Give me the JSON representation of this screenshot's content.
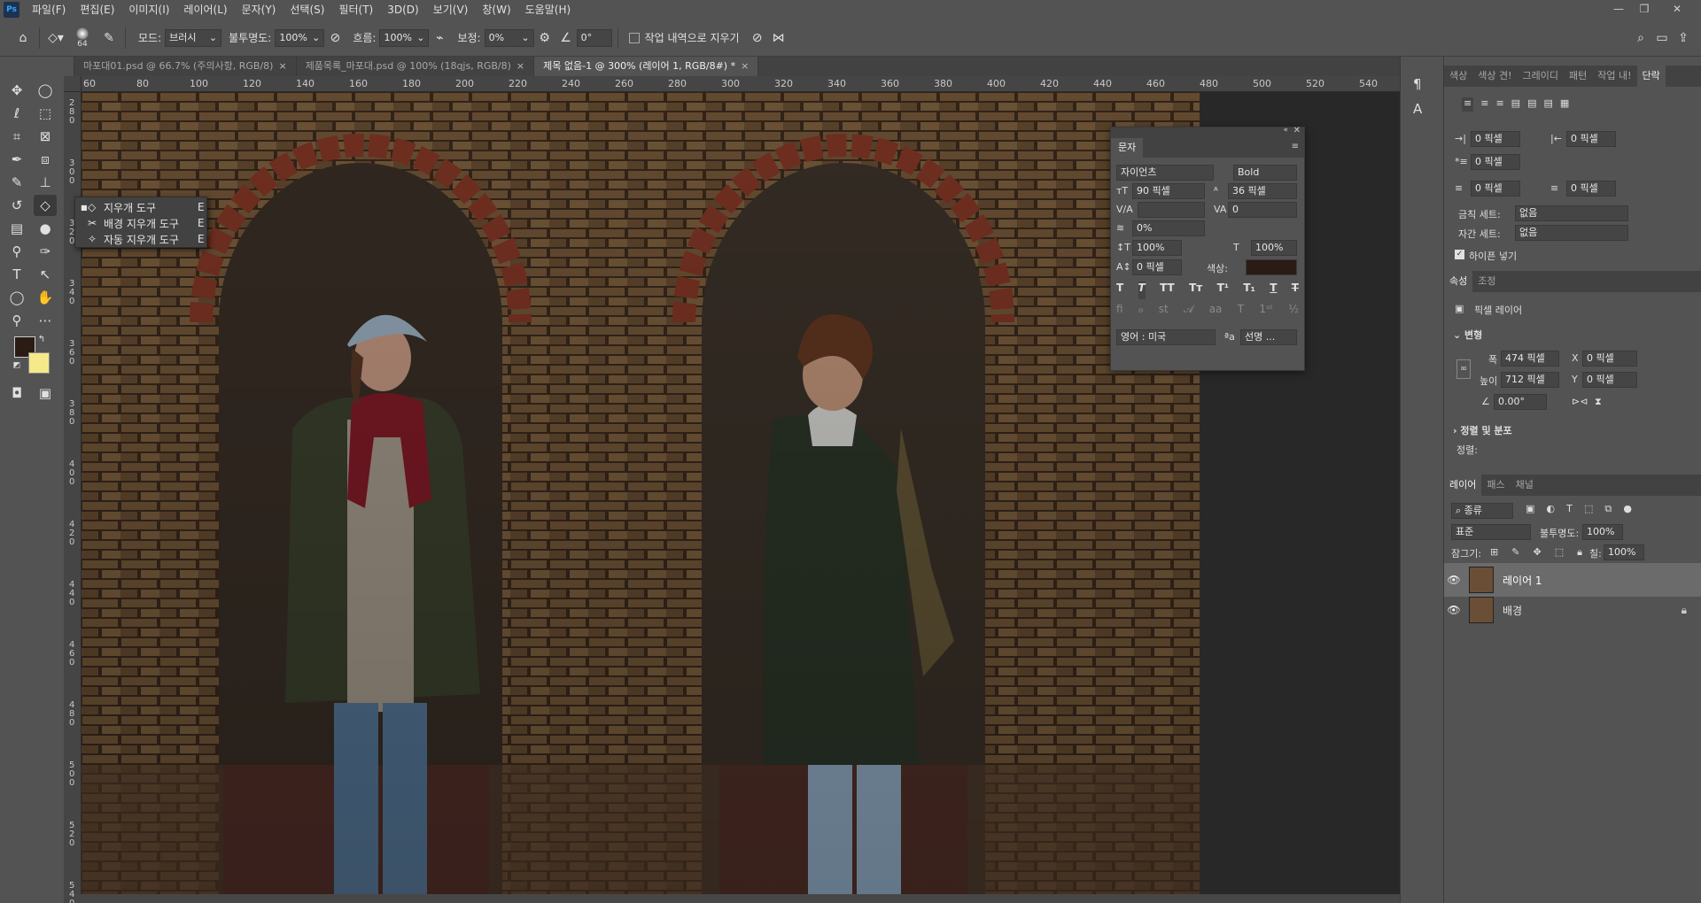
{
  "menu": {
    "logo": "Ps",
    "items": [
      "파일(F)",
      "편집(E)",
      "이미지(I)",
      "레이어(L)",
      "문자(Y)",
      "선택(S)",
      "필터(T)",
      "3D(D)",
      "보기(V)",
      "창(W)",
      "도움말(H)"
    ]
  },
  "options": {
    "brush_size": "64",
    "mode_label": "모드:",
    "mode_value": "브러시",
    "opacity_label": "불투명도:",
    "opacity_value": "100%",
    "flow_label": "흐름:",
    "flow_value": "100%",
    "smoothing_label": "보정:",
    "smoothing_value": "0%",
    "angle_value": "0°",
    "erase_history_label": "작업 내역으로 지우기"
  },
  "tabs": [
    {
      "label": "마포대01.psd @ 66.7% (주의사항, RGB/8)",
      "active": false
    },
    {
      "label": "제품목록_마포대.psd @ 100% (18qjs, RGB/8)",
      "active": false
    },
    {
      "label": "제목 없음-1 @ 300% (레이어 1, RGB/8#) *",
      "active": true
    }
  ],
  "ruler": {
    "h": [
      "60",
      "80",
      "100",
      "120",
      "140",
      "160",
      "180",
      "200",
      "220",
      "240",
      "260",
      "280",
      "300",
      "320",
      "340",
      "360",
      "380",
      "400",
      "420",
      "440",
      "460",
      "480",
      "500",
      "520",
      "540"
    ],
    "v": [
      "2 8 0",
      "3 0 0",
      "3 2 0",
      "3 4 0",
      "3 6 0",
      "3 8 0",
      "4 0 0",
      "4 2 0",
      "4 4 0",
      "4 6 0",
      "4 8 0",
      "5 0 0",
      "5 2 0",
      "5 4 0"
    ]
  },
  "eraser_flyout": [
    {
      "label": "지우개 도구",
      "shortcut": "E",
      "selected": true
    },
    {
      "label": "배경 지우개 도구",
      "shortcut": "E",
      "selected": false
    },
    {
      "label": "자동 지우개 도구",
      "shortcut": "E",
      "selected": false
    }
  ],
  "character_panel": {
    "title": "문자",
    "font_family": "자이언츠",
    "font_style": "Bold",
    "font_size": "90 픽셀",
    "leading": "36 픽셀",
    "tracking": "0",
    "vscale_rotate": "0%",
    "vertical_scale": "100%",
    "horizontal_scale": "100%",
    "baseline": "0 픽셀",
    "color_label": "색상:",
    "language": "영어 : 미국",
    "aa_label": "ªa",
    "aa_value": "선명 ..."
  },
  "paragraph_panel": {
    "tabs": [
      "색상",
      "색상 견!",
      "그레이디",
      "패턴",
      "작업 내!",
      "단락"
    ],
    "indent_left": "0 픽셀",
    "indent_right": "0 픽셀",
    "indent_first": "0 픽셀",
    "space_before": "0 픽셀",
    "space_after": "0 픽셀",
    "kinsoku_label": "금칙 세트:",
    "kinsoku_value": "없음",
    "mojikumi_label": "자간 세트:",
    "mojikumi_value": "없음",
    "hyphenate_label": "하이픈 넣기"
  },
  "properties_panel": {
    "tabs": [
      "속성",
      "조정"
    ],
    "layer_type": "픽셀 레이어",
    "transform_title": "변형",
    "width_label": "폭",
    "width_value": "474 픽셀",
    "height_label": "높이",
    "height_value": "712 픽셀",
    "x_label": "X",
    "x_value": "0 픽셀",
    "y_label": "Y",
    "y_value": "0 픽셀",
    "angle_value": "0.00°",
    "align_title": "정렬 및 분포",
    "align_label": "정렬:"
  },
  "layers_panel": {
    "tabs": [
      "레이어",
      "패스",
      "채널"
    ],
    "filter_kind": "종류",
    "blend_mode": "표준",
    "opacity_label": "불투명도:",
    "opacity_value": "100%",
    "lock_label": "잠그기:",
    "fill_label": "칠:",
    "fill_value": "100%",
    "layers": [
      {
        "name": "레이어 1",
        "selected": true
      },
      {
        "name": "배경",
        "selected": false
      }
    ]
  },
  "colors": {
    "foreground": "#2a1c14",
    "background": "#f5e98a",
    "accent": "#31a8ff",
    "panel": "#535353",
    "dark": "#424242"
  }
}
